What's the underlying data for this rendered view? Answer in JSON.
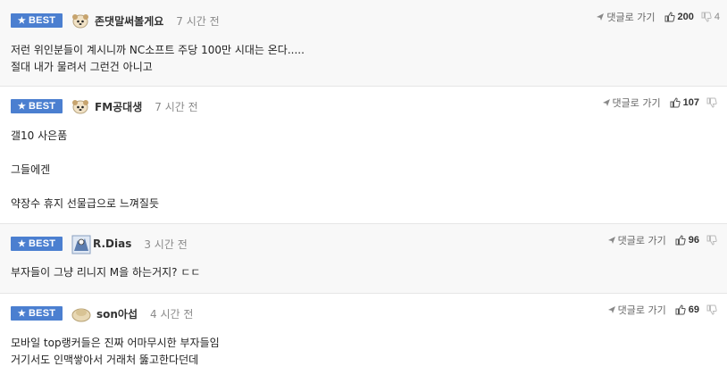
{
  "badge_label": "BEST",
  "reply_label": "댓글로 가기",
  "comments": [
    {
      "username": "존댓말써볼게요",
      "time": "7 시간 전",
      "likes": "200",
      "dislikes": "4",
      "lines": [
        "저런 위인분들이 계시니까 NC소프트 주당 100만 시대는 온다.....",
        "절대 내가 물려서 그런건 아니고"
      ]
    },
    {
      "username": "FM공대생",
      "time": "7 시간 전",
      "likes": "107",
      "dislikes": "",
      "lines": [
        "갤10 사은품",
        "",
        "그들에겐",
        "",
        "약장수 휴지 선물급으로 느껴질듯"
      ]
    },
    {
      "username": "R.Dias",
      "time": "3 시간 전",
      "likes": "96",
      "dislikes": "",
      "lines": [
        "부자들이 그냥 리니지 M을 하는거지? ㄷㄷ"
      ]
    },
    {
      "username": "son아섭",
      "time": "4 시간 전",
      "likes": "69",
      "dislikes": "",
      "lines": [
        "모바일 top랭커들은 진짜 어마무시한 부자들임",
        "거기서도 인맥쌓아서 거래처 뚫고한다던데"
      ]
    }
  ]
}
